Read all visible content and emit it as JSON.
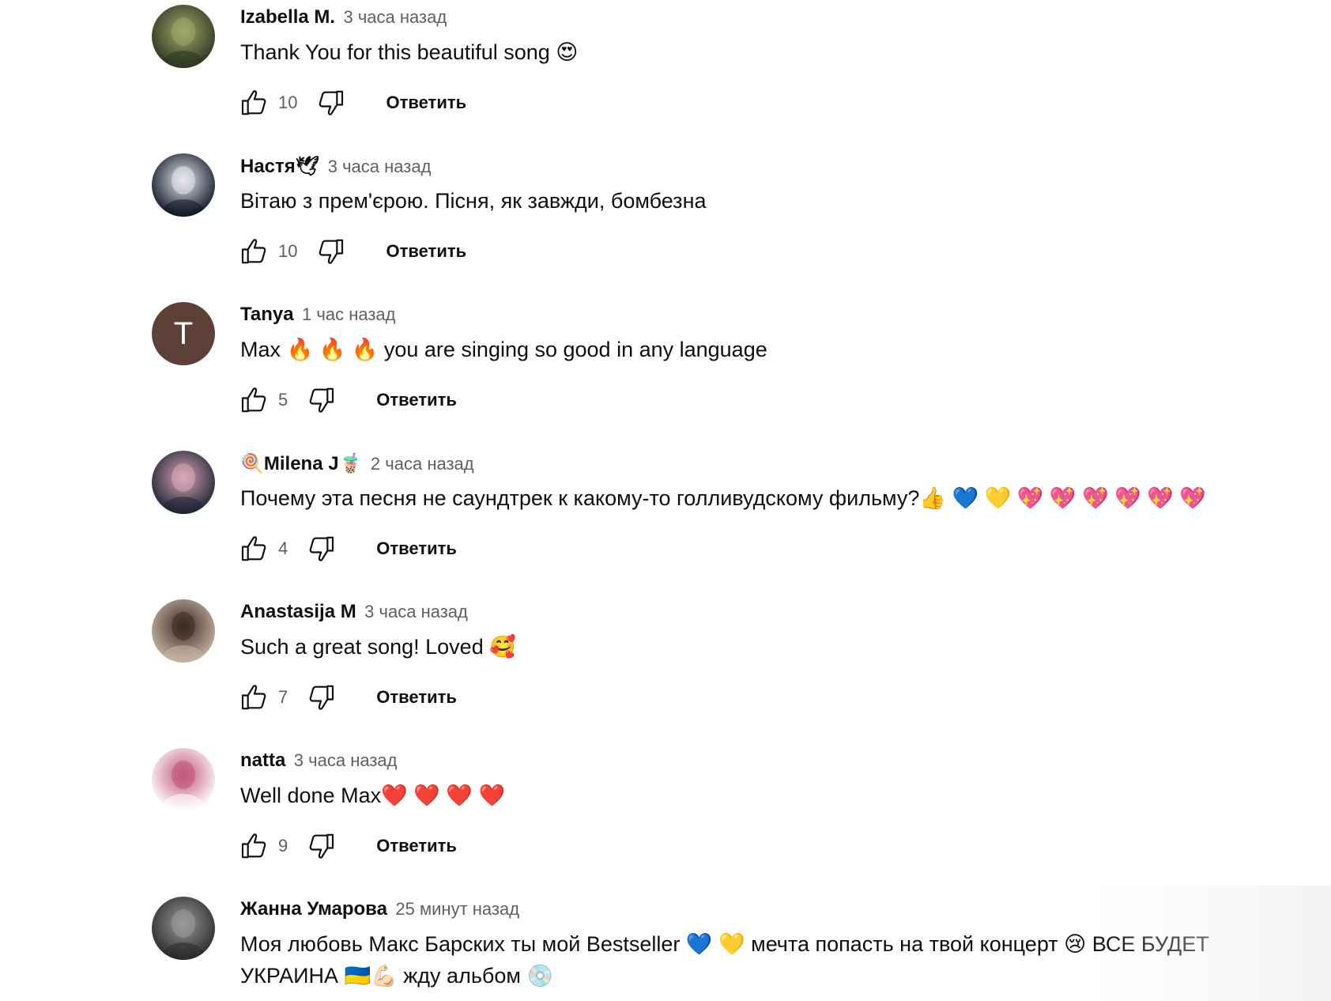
{
  "comments": [
    {
      "author": "Izabella M.",
      "time": "3 часа назад",
      "text": "Thank You for this beautiful song 😍",
      "likes": "10",
      "reply_label": "Ответить",
      "avatar": {
        "type": "photo",
        "colors": [
          "#2c3520",
          "#a0a86a"
        ]
      }
    },
    {
      "author": "Настя🕊",
      "time": "3 часа назад",
      "text": "Вітаю з прем'єрою. Пісня, як завжди, бомбезна",
      "likes": "10",
      "reply_label": "Ответить",
      "avatar": {
        "type": "photo",
        "colors": [
          "#0c1626",
          "#e8e8ec"
        ]
      }
    },
    {
      "author": "Tanya",
      "time": "1 час назад",
      "text": "Max 🔥 🔥 🔥 you are singing so good in any language",
      "likes": "5",
      "reply_label": "Ответить",
      "avatar": {
        "type": "letter",
        "letter": "T",
        "colors": [
          "#5d4037",
          "#5d4037"
        ]
      }
    },
    {
      "author": "🍭Milena J🧋",
      "time": "2 часа назад",
      "text": "Почему эта песня не саундтрек к какому-то голливудскому фильму?👍 💙 💛 💖 💖 💖 💖 💖 💖",
      "likes": "4",
      "reply_label": "Ответить",
      "avatar": {
        "type": "photo",
        "colors": [
          "#1b2233",
          "#d9a7b4"
        ]
      }
    },
    {
      "author": "Anastasija M",
      "time": "3 часа назад",
      "text": "Such a great song! Loved 🥰",
      "likes": "7",
      "reply_label": "Ответить",
      "avatar": {
        "type": "photo",
        "colors": [
          "#c8b5a4",
          "#3a2a22"
        ]
      }
    },
    {
      "author": "natta",
      "time": "3 часа назад",
      "text": "Well done Max❤️ ❤️ ❤️ ❤️",
      "likes": "9",
      "reply_label": "Ответить",
      "avatar": {
        "type": "photo",
        "colors": [
          "#ffffff",
          "#c0557a"
        ]
      }
    },
    {
      "author": "Жанна Умарова",
      "time": "25 минут назад",
      "text": "Моя любовь Макс Барских ты мой Bestseller 💙 💛 мечта попасть на твой концерт 😢 ВСЕ БУДЕТ УКРАИНА 🇺🇦💪🏻 жду альбом 💿",
      "likes": "",
      "reply_label": "",
      "avatar": {
        "type": "photo",
        "colors": [
          "#2a2a2a",
          "#9a9a9a"
        ]
      }
    }
  ]
}
